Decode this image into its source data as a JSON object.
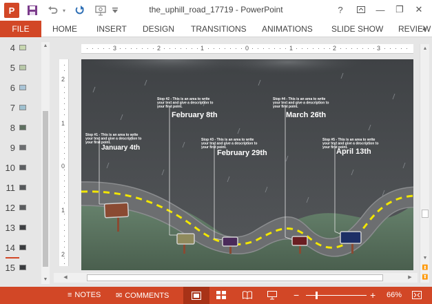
{
  "titlebar": {
    "title": "the_uphill_road_17719 - PowerPoint",
    "app_icon": "P",
    "icons": [
      "save-icon",
      "undo-icon",
      "redo-icon",
      "start-slideshow-icon",
      "customize-qat-icon"
    ],
    "help": "?",
    "minimize": "—",
    "restore": "❐",
    "close": "✕"
  },
  "ribbon": {
    "file_label": "FILE",
    "tabs": [
      "HOME",
      "INSERT",
      "DESIGN",
      "TRANSITIONS",
      "ANIMATIONS",
      "SLIDE SHOW",
      "REVIEW"
    ],
    "accent": "#d24726"
  },
  "thumbnails": {
    "numbers": [
      "4",
      "5",
      "6",
      "7",
      "8",
      "9",
      "10",
      "11",
      "12",
      "13",
      "14",
      "15"
    ],
    "current": "14"
  },
  "ruler": {
    "h_labels": [
      "3",
      "2",
      "1",
      "0",
      "1",
      "2",
      "3"
    ],
    "v_labels": [
      "2",
      "1",
      "0",
      "1",
      "2"
    ]
  },
  "slide": {
    "stops": [
      {
        "caption": "Stop #1 - This is an area to write your text and give a description to your first point.",
        "date": "January 4th",
        "sign_color": "#8a4a32"
      },
      {
        "caption": "Stop #2 - This is an area to write your text and give a description to your first point.",
        "date": "February 8th",
        "sign_color": "#8f8a5c"
      },
      {
        "caption": "Stop #3 - This is an area to write your text and give a description to your first point.",
        "date": "February 29th",
        "sign_color": "#4a2a5a"
      },
      {
        "caption": "Stop #4 - This is an area to write your text and give a description to your first point.",
        "date": "March 26th",
        "sign_color": "#6a1e22"
      },
      {
        "caption": "Stop #5 - This is an area to write your text and give a description to your first point.",
        "date": "April 13th",
        "sign_color": "#1e2f66"
      }
    ],
    "colors": {
      "sky": "#4a4d50",
      "road": "#6e6f71",
      "hill": "#5f7a64",
      "dash": "#f2e600"
    }
  },
  "status": {
    "notes_label": "NOTES",
    "comments_label": "COMMENTS",
    "zoom_minus": "−",
    "zoom_plus": "+",
    "zoom_level": "66%",
    "zoom_fraction": 0.66,
    "view_icons": [
      "normal-view-icon",
      "slide-sorter-icon",
      "reading-view-icon",
      "slideshow-view-icon",
      "fit-slide-icon"
    ]
  }
}
